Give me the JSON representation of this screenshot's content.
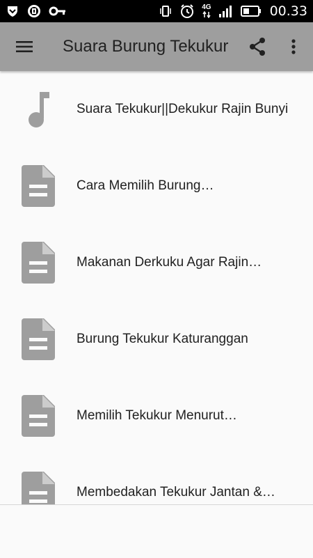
{
  "status_bar": {
    "time": "00.33",
    "network": "4G",
    "icons": [
      "notification-shield-icon",
      "notification-app-icon",
      "vpn-key-icon",
      "vibrate-icon",
      "alarm-icon",
      "data-arrows-icon",
      "signal-icon",
      "battery-icon"
    ]
  },
  "app_bar": {
    "title": "Suara Burung Tekukur"
  },
  "list": {
    "items": [
      {
        "icon": "music-note-icon",
        "label": "Suara Tekukur||Dekukur Rajin Bunyi"
      },
      {
        "icon": "document-icon",
        "label": "Cara Memilih Burung…"
      },
      {
        "icon": "document-icon",
        "label": "Makanan Derkuku Agar Rajin…"
      },
      {
        "icon": "document-icon",
        "label": "Burung Tekukur Katuranggan"
      },
      {
        "icon": "document-icon",
        "label": "Memilih Tekukur Menurut…"
      },
      {
        "icon": "document-icon",
        "label": "Membedakan Tekukur Jantan &…"
      }
    ]
  },
  "colors": {
    "app_bar": "#9e9e9e",
    "icon_gray": "#9e9e9e",
    "background": "#fafafa",
    "text": "#212121"
  }
}
